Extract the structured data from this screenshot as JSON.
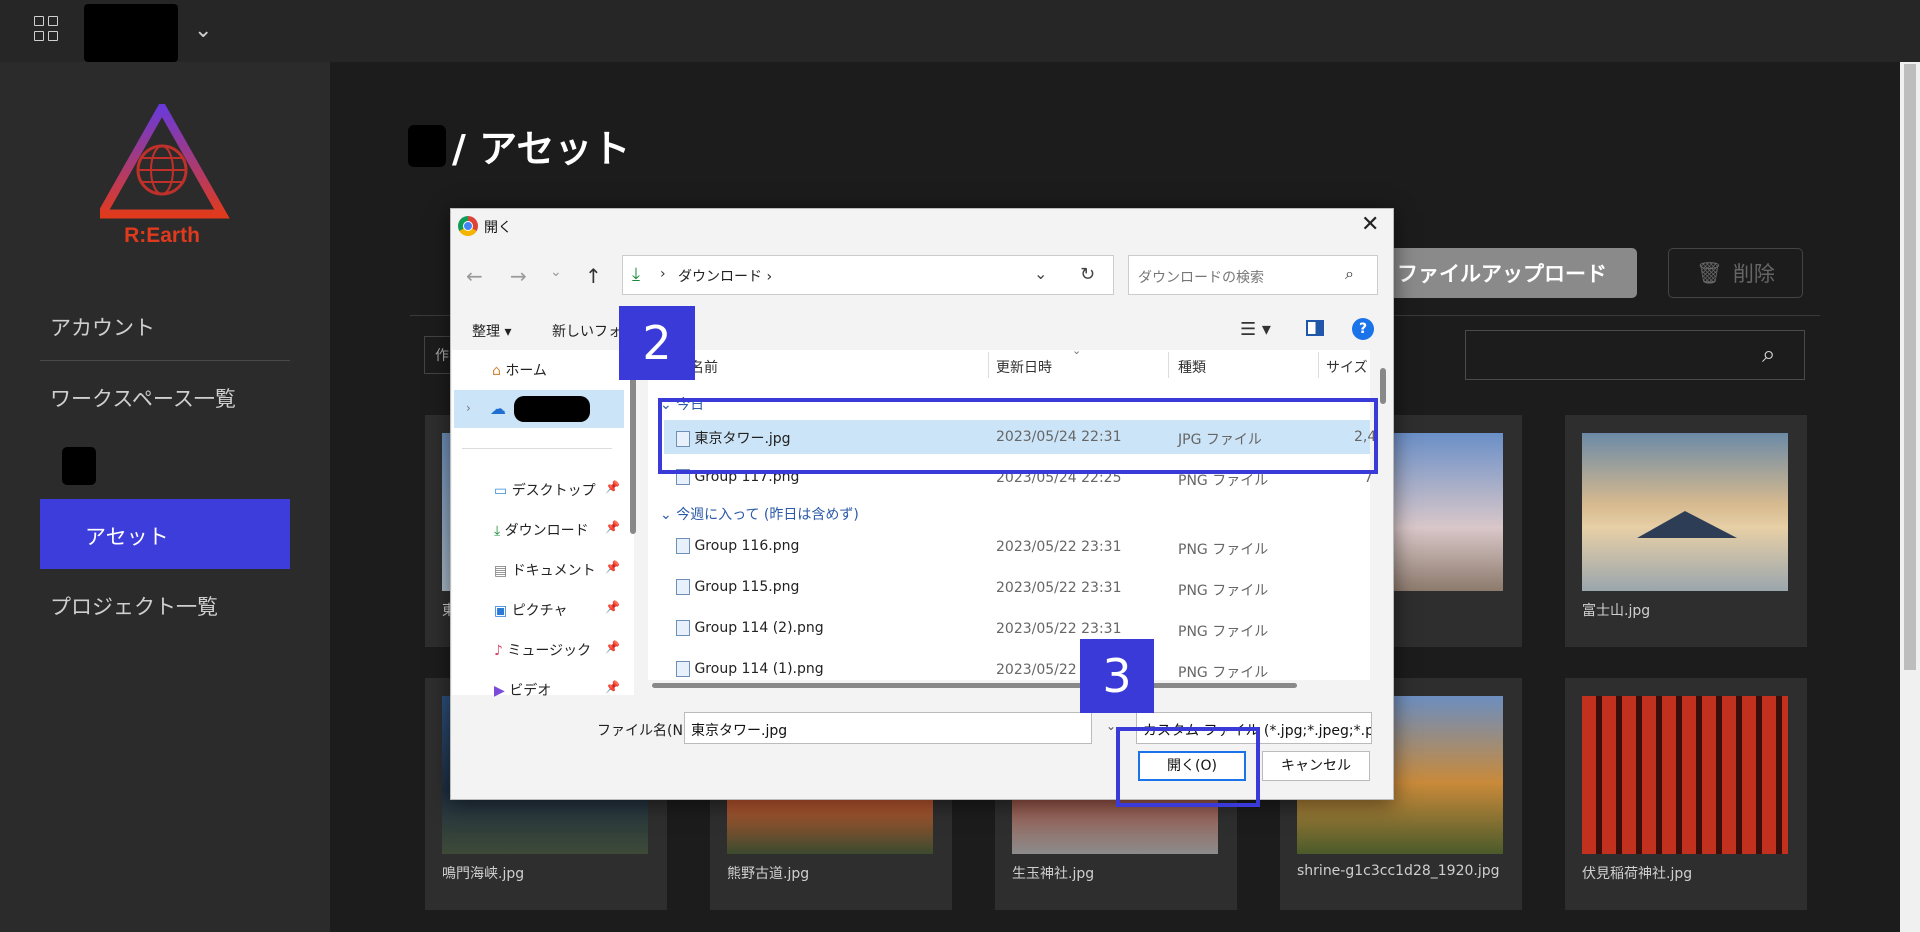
{
  "sidebar": {
    "logo_text": "R:Earth",
    "items": [
      {
        "label": "アカウント"
      },
      {
        "label": "ワークスペース一覧"
      },
      {
        "label": "アセット"
      },
      {
        "label": "プロジェクト一覧"
      }
    ]
  },
  "main": {
    "title": "/ アセット",
    "upload_button": "ファイルアップロード",
    "delete_button": "削除",
    "filter_stub": "作",
    "cards_row1": [
      {
        "caption": "東"
      },
      {
        "caption": ""
      },
      {
        "caption": ""
      },
      {
        "caption": ""
      },
      {
        "caption": "富士山.jpg"
      }
    ],
    "cards_row2": [
      {
        "caption": "鳴門海峡.jpg"
      },
      {
        "caption": "熊野古道.jpg"
      },
      {
        "caption": "生玉神社.jpg"
      },
      {
        "caption": "shrine-g1c3cc1d28_1920.jpg"
      },
      {
        "caption": "伏見稲荷神社.jpg"
      }
    ]
  },
  "dialog": {
    "title": "開く",
    "address": "ダウンロード ›",
    "address_sep": "›",
    "search_placeholder": "ダウンロードの検索",
    "organize": "整理 ▾",
    "new_folder": "新しいフォル",
    "help": "?",
    "nav": [
      {
        "label": "ホーム",
        "icon": "home-icon"
      },
      {
        "label": "デスクトップ",
        "icon": "desktop-icon"
      },
      {
        "label": "ダウンロード",
        "icon": "download-icon"
      },
      {
        "label": "ドキュメント",
        "icon": "document-icon"
      },
      {
        "label": "ピクチャ",
        "icon": "picture-icon"
      },
      {
        "label": "ミュージック",
        "icon": "music-icon"
      },
      {
        "label": "ビデオ",
        "icon": "video-icon"
      }
    ],
    "columns": {
      "name": "名前",
      "date": "更新日時",
      "type": "種類",
      "size": "サイズ"
    },
    "groups": {
      "today": "今日",
      "this_week": "今週に入って (昨日は含めず)"
    },
    "files": [
      {
        "name": "東京タワー.jpg",
        "date": "2023/05/24 22:31",
        "type": "JPG ファイル",
        "size": "2,4"
      },
      {
        "name": "Group 117.png",
        "date": "2023/05/24 22:25",
        "type": "PNG ファイル",
        "size": "7"
      },
      {
        "name": "Group 116.png",
        "date": "2023/05/22 23:31",
        "type": "PNG ファイル",
        "size": ""
      },
      {
        "name": "Group 115.png",
        "date": "2023/05/22 23:31",
        "type": "PNG ファイル",
        "size": ""
      },
      {
        "name": "Group 114 (2).png",
        "date": "2023/05/22 23:31",
        "type": "PNG ファイル",
        "size": ""
      },
      {
        "name": "Group 114 (1).png",
        "date": "2023/05/22",
        "type": "PNG ファイル",
        "size": ""
      }
    ],
    "filename_label": "ファイル名(N):",
    "filename_value": "東京タワー.jpg",
    "filetype_value": "カスタム ファイル (*.jpg;*.jpeg;*.png",
    "open_button": "開く(O)",
    "cancel_button": "キャンセル"
  },
  "callouts": {
    "step2": "2",
    "step3": "3"
  },
  "colors": {
    "accent": "#3d3ddb",
    "callout": "#3a3ad8",
    "logo_red": "#e03a1e"
  }
}
